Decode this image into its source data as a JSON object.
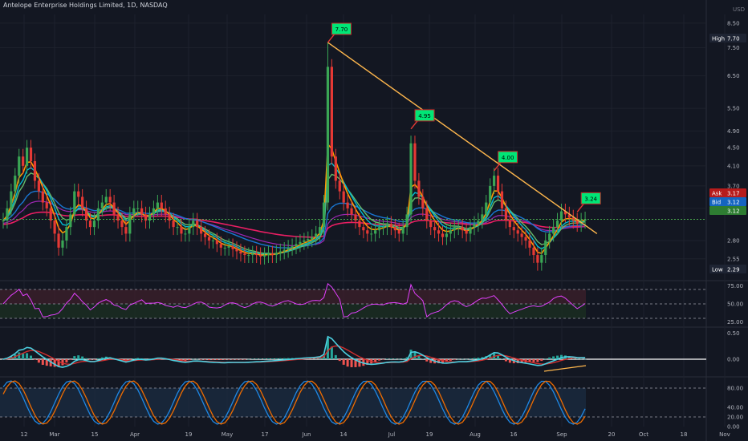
{
  "header": {
    "title": "Antelope Enterprise Holdings Limited, 1D, NASDAQ",
    "currency": "USD"
  },
  "colors": {
    "background": "#131722",
    "up": "#26a69a",
    "up_candle": "#3aa655",
    "down_candle": "#e53935",
    "bid_line": "#4caf50",
    "trend_line": "#ffb74d",
    "ema_fast": "#ff9800",
    "ema_mid": "#00bcd4",
    "ema_slow": "#1976d2",
    "sma": "#e91e63",
    "rsi_line": "#e040fb",
    "macd_line": "#4dd0e1",
    "signal_line": "#d32f2f",
    "stoch_k": "#1e88e5",
    "stoch_d": "#ef6c00"
  },
  "chart_data": [
    {
      "type": "candlestick",
      "panel": "price",
      "scale": "log",
      "ylim": [
        2.29,
        8.5
      ],
      "y_ticks": [
        "8.50",
        "7.50",
        "6.50",
        "5.50",
        "4.90",
        "4.50",
        "4.10",
        "3.70",
        "3.30",
        "2.80",
        "2.55"
      ],
      "x_ticks": [
        "12",
        "Mar",
        "15",
        "Apr",
        "19",
        "May",
        "17",
        "Jun",
        "14",
        "Jul",
        "19",
        "Aug",
        "16",
        "Sep",
        "20",
        "Oct",
        "18",
        "Nov"
      ],
      "labels": {
        "high": {
          "label": "High",
          "value": "7.70"
        },
        "low": {
          "label": "Low",
          "value": "2.29"
        },
        "ask": {
          "label": "Ask",
          "value": "3.17"
        },
        "bid": {
          "label": "Bid",
          "value": "3.12"
        },
        "last": {
          "value": "3.12"
        }
      },
      "annotations": [
        {
          "text": "7.70",
          "day": 82,
          "price": 7.7
        },
        {
          "text": "4.95",
          "day": 103,
          "price": 4.95
        },
        {
          "text": "4.00",
          "day": 124,
          "price": 4.0
        },
        {
          "text": "3.24",
          "day": 145,
          "price": 3.24
        }
      ],
      "trendline": {
        "from": {
          "day": 82,
          "price": 7.7
        },
        "to": {
          "day": 150,
          "price": 2.9
        }
      },
      "closes": [
        3.1,
        3.3,
        3.6,
        3.9,
        4.3,
        4.1,
        4.5,
        4.2,
        3.8,
        3.6,
        3.4,
        3.3,
        3.1,
        2.9,
        2.7,
        2.8,
        3.0,
        3.2,
        3.6,
        3.5,
        3.3,
        3.1,
        3.0,
        3.1,
        3.3,
        3.4,
        3.5,
        3.4,
        3.2,
        3.1,
        3.0,
        2.9,
        3.2,
        3.3,
        3.3,
        3.2,
        3.1,
        3.2,
        3.3,
        3.4,
        3.3,
        3.2,
        3.1,
        3.0,
        3.0,
        2.9,
        2.9,
        3.0,
        3.1,
        3.0,
        2.9,
        2.85,
        2.8,
        2.8,
        2.75,
        2.7,
        2.7,
        2.72,
        2.68,
        2.65,
        2.62,
        2.6,
        2.6,
        2.62,
        2.6,
        2.58,
        2.6,
        2.62,
        2.6,
        2.63,
        2.65,
        2.67,
        2.7,
        2.72,
        2.75,
        2.78,
        2.8,
        2.82,
        2.85,
        2.9,
        3.0,
        3.4,
        6.8,
        4.3,
        3.8,
        3.6,
        3.4,
        3.3,
        3.2,
        3.1,
        3.0,
        2.95,
        2.9,
        2.9,
        2.95,
        3.0,
        3.0,
        3.05,
        3.0,
        2.95,
        2.9,
        3.0,
        3.2,
        4.6,
        3.8,
        3.5,
        3.3,
        3.1,
        3.0,
        2.95,
        2.9,
        2.85,
        2.9,
        2.95,
        3.0,
        3.0,
        2.95,
        2.9,
        3.0,
        3.05,
        3.1,
        3.2,
        3.4,
        3.7,
        3.9,
        3.6,
        3.3,
        3.1,
        3.0,
        2.95,
        2.9,
        2.85,
        2.8,
        2.7,
        2.6,
        2.5,
        2.6,
        2.8,
        2.9,
        3.0,
        3.1,
        3.25,
        3.2,
        3.15,
        3.1,
        3.05,
        3.1,
        3.12
      ]
    },
    {
      "type": "line",
      "panel": "rsi",
      "y_ticks": [
        "75.00",
        "50.00",
        "25.00"
      ],
      "levels": [
        70,
        50,
        30
      ]
    },
    {
      "type": "histogram+line",
      "panel": "macd",
      "y_ticks": [
        "0.50",
        "0.00"
      ]
    },
    {
      "type": "line",
      "panel": "stochastic",
      "y_ticks": [
        "80.00",
        "40.00",
        "20.00",
        "0.00"
      ],
      "levels": [
        80,
        20
      ]
    }
  ]
}
